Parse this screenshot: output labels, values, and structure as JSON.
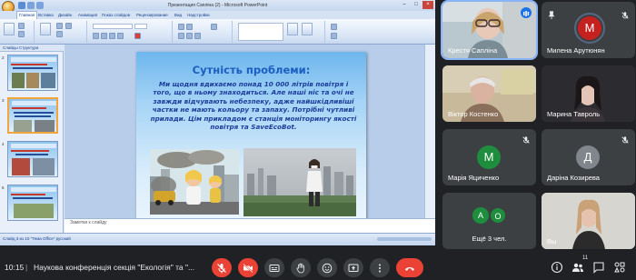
{
  "ppt": {
    "window_title": "Презентация Сапліна (2) - Microsoft PowerPoint",
    "tabs": [
      "Главная",
      "Вставка",
      "Дизайн",
      "Анимация",
      "Показ слайдов",
      "Рецензирование",
      "Вид",
      "Надстройки"
    ],
    "pane_tab": "Слайды   Структура",
    "slide_numbers": [
      "2",
      "3",
      "4",
      "5"
    ],
    "notes_placeholder": "Заметки к слайду",
    "status_text": "Слайд 3 из 10   \"Тема Office\"   русский"
  },
  "slide": {
    "title": "Сутність проблеми:",
    "body": "Ми щодня вдихаємо понад 10 000 літрів повітря і того, що в ньому знаходиться. Але наші ніс та очі не завжди відчувають небезпеку, адже найшкідливіші частки не мають кольору та запаху. Потрібні чутливі прилади. Цім прикладом є станція моніторингу якості повітря та  SaveEcoBot."
  },
  "participants": [
    {
      "name": "Крестя Сапліна",
      "speaking": true
    },
    {
      "name": "Милена Арутюнян",
      "avatar_letter": "M",
      "avatar_color": "#c5221f"
    },
    {
      "name": "Віктор Костенко"
    },
    {
      "name": "Марина Тавроль"
    },
    {
      "name": "Марія Яциченко",
      "avatar_letter": "M",
      "avatar_color": "#1e8e3e"
    },
    {
      "name": "Даріна Козирева",
      "avatar_letter": "Д",
      "avatar_color": "#80868b"
    },
    {
      "name": "Ещё 3 чел.",
      "avatar_letters": [
        "А",
        "О"
      ]
    },
    {
      "name": "Вы"
    }
  ],
  "meeting": {
    "time": "10:15",
    "separator": "|",
    "name": "Наукова конференція секція \"Екологія\" та \"...",
    "participants_count": "11"
  },
  "colors": {
    "accent": "#8ab4f8",
    "end_call": "#ea4335",
    "tile_bg": "#3c4043",
    "slide_title": "#1a5ec0"
  }
}
